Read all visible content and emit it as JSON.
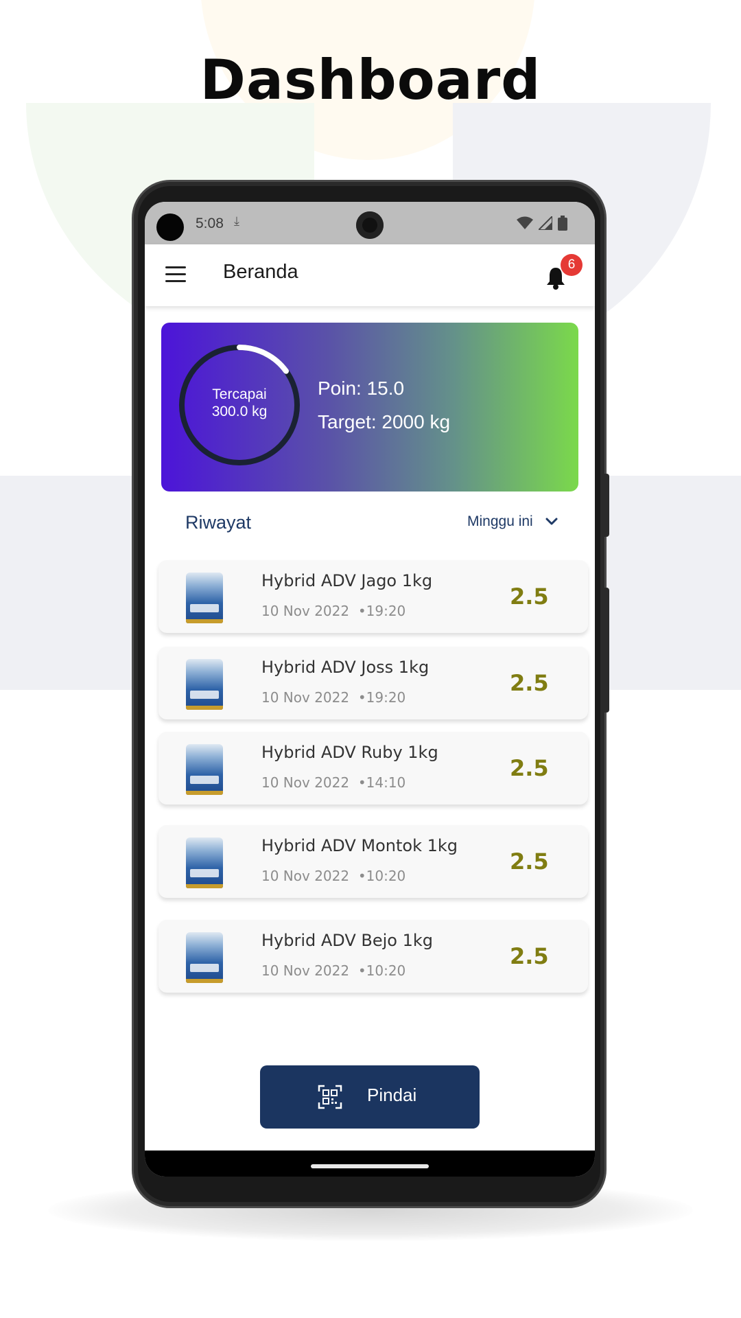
{
  "page": {
    "title": "Dashboard"
  },
  "status_bar": {
    "time": "5:08"
  },
  "app_bar": {
    "title": "Beranda",
    "notification_count": "6"
  },
  "summary": {
    "ring_label": "Tercapai",
    "ring_value": "300.0 kg",
    "progress_fraction": 0.15,
    "poin": "Poin: 15.0",
    "target": "Target: 2000 kg",
    "gradient": [
      "#4c14d9",
      "#7bd94b"
    ]
  },
  "history": {
    "title": "Riwayat",
    "filter_label": "Minggu ini",
    "items": [
      {
        "name": "Hybrid ADV Jago 1kg",
        "date": "10 Nov 2022",
        "time": "19:20",
        "value": "2.5"
      },
      {
        "name": "Hybrid ADV Joss 1kg",
        "date": "10 Nov 2022",
        "time": "19:20",
        "value": "2.5"
      },
      {
        "name": "Hybrid ADV Ruby 1kg",
        "date": "10 Nov 2022",
        "time": "14:10",
        "value": "2.5"
      },
      {
        "name": "Hybrid ADV Montok 1kg",
        "date": "10 Nov 2022",
        "time": "10:20",
        "value": "2.5"
      },
      {
        "name": "Hybrid ADV Bejo 1kg",
        "date": "10 Nov 2022",
        "time": "10:20",
        "value": "2.5"
      }
    ]
  },
  "scan_button": {
    "label": "Pindai",
    "icon": "qr-scan-icon"
  },
  "colors": {
    "primary": "#1b3560",
    "accent_value": "#807d12",
    "badge": "#e53935"
  }
}
